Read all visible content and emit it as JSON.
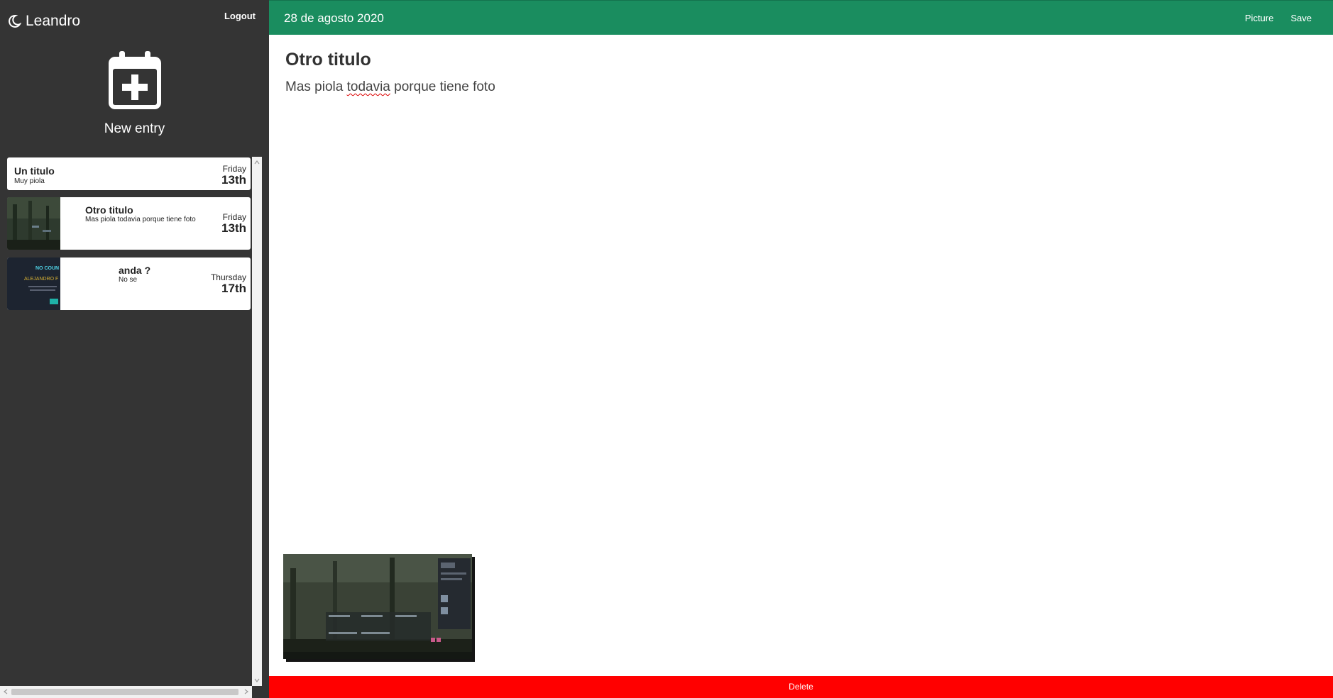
{
  "sidebar": {
    "brand": "Leandro",
    "logout_label": "Logout",
    "new_entry_label": "New entry",
    "entries": [
      {
        "title": "Un titulo",
        "description": "Muy piola",
        "weekday": "Friday",
        "day": "13th",
        "has_picture": false
      },
      {
        "title": "Otro titulo",
        "description": "Mas piola todavia porque tiene foto",
        "weekday": "Friday",
        "day": "13th",
        "has_picture": true
      },
      {
        "title": "anda ?",
        "description": "No se",
        "weekday": "Thursday",
        "day": "17th",
        "has_picture": true
      }
    ],
    "thumb_text": {
      "line1": "NO COUN",
      "line2": "ALEJANDRO F"
    }
  },
  "header": {
    "date": "28 de agosto 2020",
    "picture_label": "Picture",
    "save_label": "Save"
  },
  "entry_view": {
    "title": "Otro titulo",
    "body_before": "Mas piola ",
    "body_misspelled": "todavia",
    "body_after": " porque tiene foto"
  },
  "footer": {
    "delete_label": "Delete"
  },
  "colors": {
    "sidebar_bg": "#343434",
    "header_bg": "#1a8d5f",
    "delete_bg": "#ff0000"
  }
}
